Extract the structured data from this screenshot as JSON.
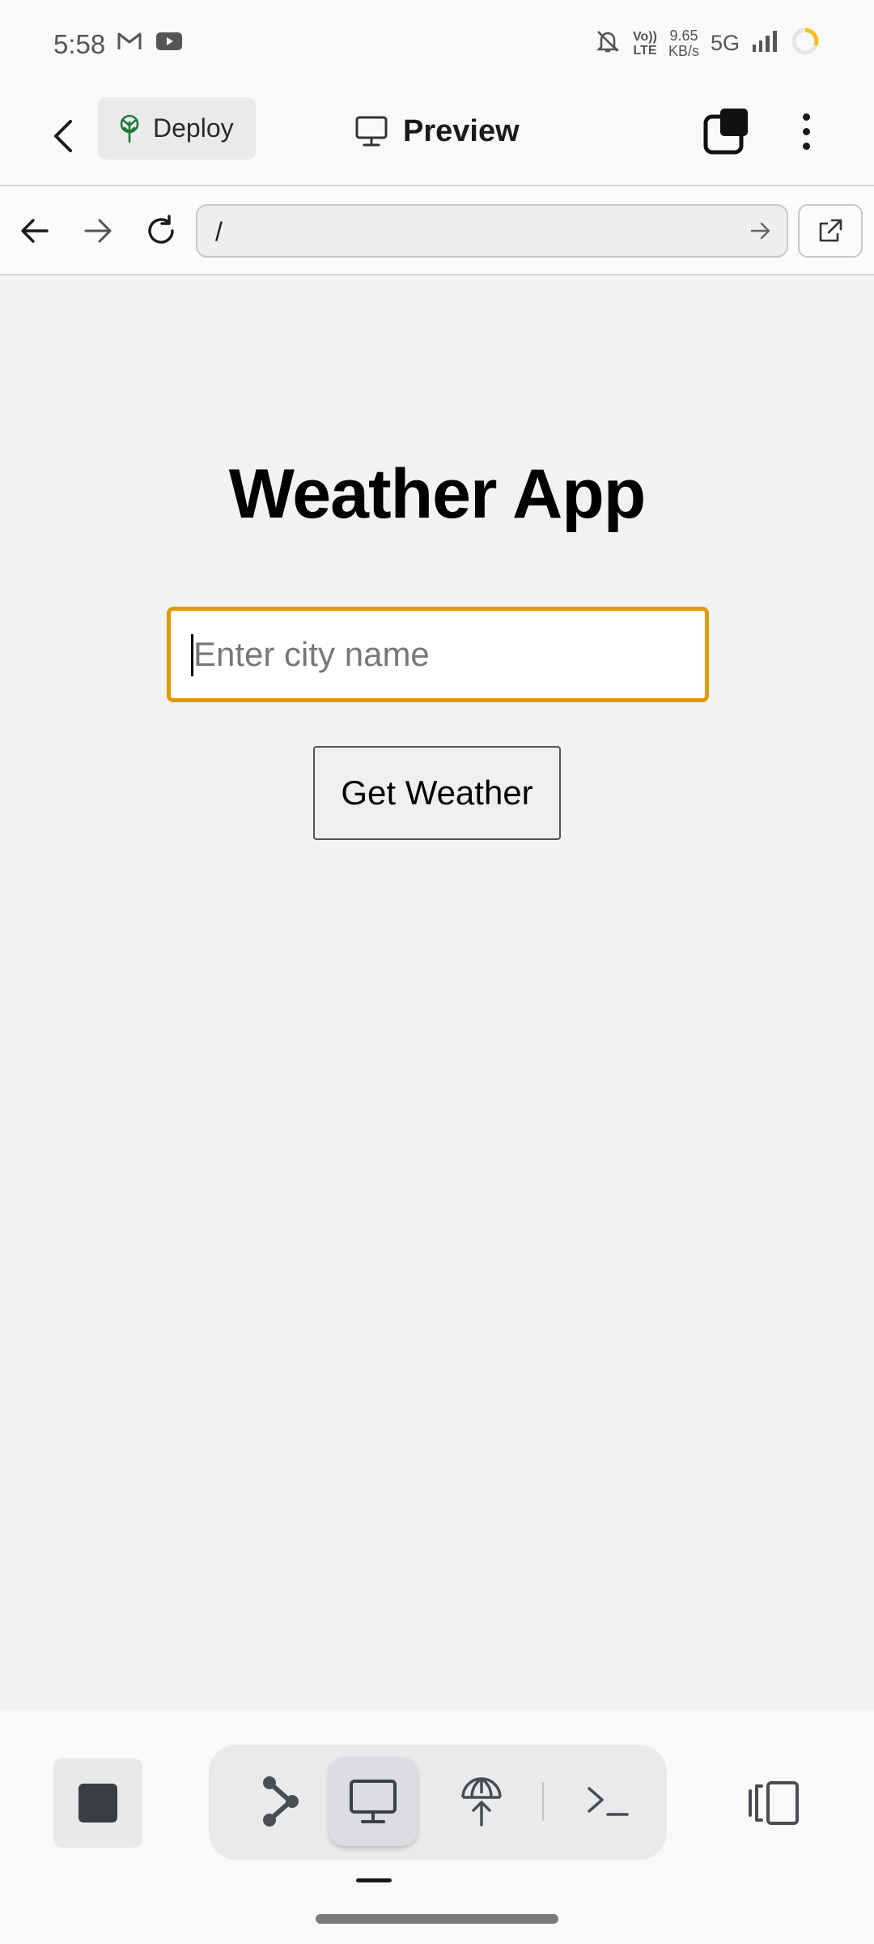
{
  "status_bar": {
    "time": "5:58",
    "left_icons": [
      "gmail-icon",
      "youtube-icon"
    ],
    "right_icons": [
      "bell-off-icon",
      "volte-icon",
      "signal-icon",
      "battery-ring-icon"
    ],
    "volte_top": "Vo))",
    "volte_bottom": "LTE",
    "net_speed_value": "9.65",
    "net_speed_unit": "KB/s",
    "network": "5G"
  },
  "header": {
    "back_icon": "chevron-left-icon",
    "deploy_label": "Deploy",
    "deploy_icon": "deploy-tree-icon",
    "title": "Preview",
    "title_icon": "monitor-icon",
    "tabs_icon": "tabs-stack-icon",
    "menu_icon": "kebab-menu-icon"
  },
  "browser": {
    "back_icon": "arrow-left-icon",
    "forward_icon": "arrow-right-icon",
    "reload_icon": "reload-icon",
    "url": "/",
    "go_icon": "arrow-right-icon",
    "open_external_icon": "external-link-icon"
  },
  "page": {
    "title": "Weather App",
    "input_placeholder": "Enter city name",
    "input_value": "",
    "button_label": "Get Weather"
  },
  "bottom_bar": {
    "stop_icon": "stop-icon",
    "tools": [
      {
        "icon": "git-branch-icon",
        "active": false
      },
      {
        "icon": "monitor-icon",
        "active": true
      },
      {
        "icon": "deploy-globe-icon",
        "active": false
      },
      {
        "icon": "terminal-icon",
        "active": false
      }
    ],
    "layout_icon": "split-layout-icon"
  },
  "colors": {
    "input_focus": "#e09a08",
    "deploy_tree": "#1f7a3a",
    "background": "#f2f2f2"
  }
}
